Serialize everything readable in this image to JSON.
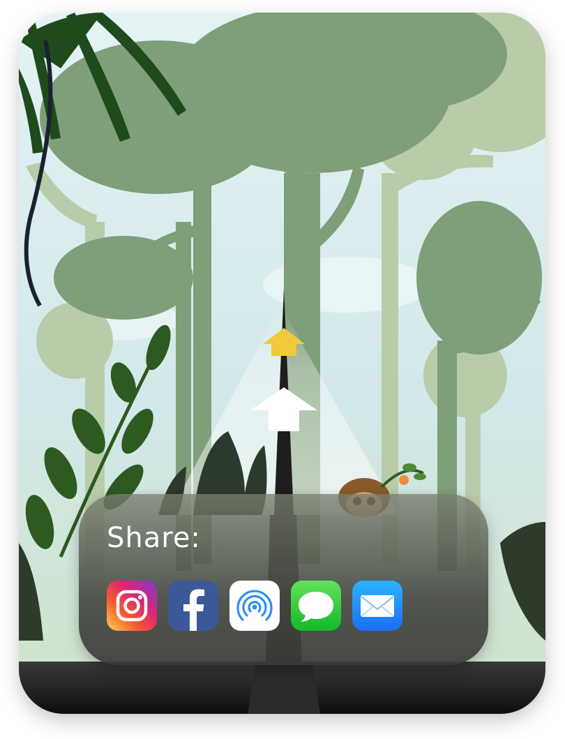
{
  "share": {
    "title": "Share:",
    "options": [
      {
        "id": "instagram",
        "label": "Instagram",
        "icon": "instagram-icon"
      },
      {
        "id": "facebook",
        "label": "Facebook",
        "icon": "facebook-icon"
      },
      {
        "id": "airdrop",
        "label": "AirDrop",
        "icon": "airdrop-icon"
      },
      {
        "id": "messages",
        "label": "Messages",
        "icon": "messages-icon"
      },
      {
        "id": "mail",
        "label": "Mail",
        "icon": "mail-icon"
      }
    ]
  },
  "scene": {
    "arrow_colors": {
      "upper": "#f3c93c",
      "lower": "#ffffff"
    },
    "palette": {
      "sky": "#d7ebee",
      "far_trees": "#b6c9a8",
      "mid_trees": "#7f9d7a",
      "near_leaves": "#1f4a1c",
      "road": "#1e1e1e"
    }
  }
}
